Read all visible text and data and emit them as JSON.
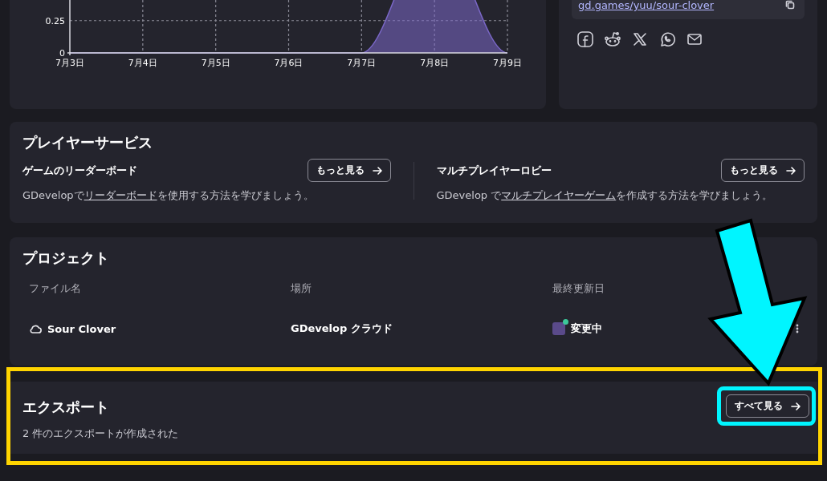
{
  "analytics": {
    "chart_data": {
      "type": "area",
      "categories": [
        "7月3日",
        "7月4日",
        "7月5日",
        "7月6日",
        "7月7日",
        "7月8日",
        "7月9日"
      ],
      "series": [
        {
          "color": "#7b68c8",
          "values": [
            0,
            0,
            0,
            0,
            0,
            null,
            0
          ]
        }
      ],
      "ylim": [
        0,
        0.41
      ],
      "grid": true,
      "yticks": [
        {
          "value": 0,
          "label": "0"
        },
        {
          "value": 0.25,
          "label": "0.25"
        }
      ]
    }
  },
  "share": {
    "link": "gd.games/yuu/sour-clover"
  },
  "player_services": {
    "title": "プレイヤーサービス",
    "items": [
      {
        "title": "ゲームのリーダーボード",
        "button": "もっと見る",
        "description_before": "GDevelopで",
        "description_link": "リーダーボード",
        "description_after": "を使用する方法を学びましょう。"
      },
      {
        "title": "マルチプレイヤーロビー",
        "button": "もっと見る",
        "description_before": "GDevelop で",
        "description_link": "マルチプレイヤーゲーム",
        "description_after": "を作成する方法を学びましょう。"
      }
    ]
  },
  "projects": {
    "title": "プロジェクト",
    "columns": [
      "ファイル名",
      "場所",
      "最終更新日"
    ],
    "rows": [
      {
        "name": "Sour Clover",
        "location": "GDevelop クラウド",
        "modified": "変更中",
        "online": true
      }
    ]
  },
  "exports": {
    "title": "エクスポート",
    "description": "2 件のエクスポートが作成された",
    "button": "すべて見る"
  }
}
